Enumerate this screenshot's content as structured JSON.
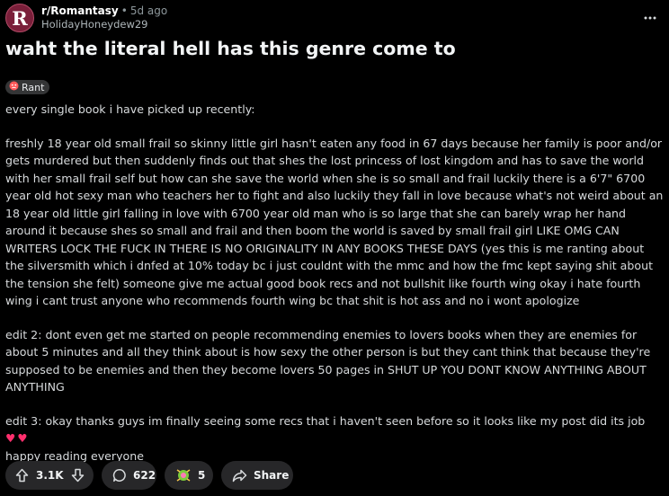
{
  "post": {
    "subreddit": "r/Romantasy",
    "separator": "•",
    "age": "5d ago",
    "author": "HolidayHoneydew29",
    "avatar_letter": "R",
    "title": "waht the literal hell has this genre come to",
    "flair": {
      "label": "Rant",
      "icon": "angry-face-icon"
    },
    "paragraphs": [
      "every single book i have picked up recently:",
      "freshly 18 year old small frail so skinny little girl hasn't eaten any food in 67 days because her family is poor and/or gets murdered but then suddenly finds out that shes the lost princess of lost kingdom and has to save the world with her small frail self but how can she save the world when she is so small and frail luckily there is a 6'7\" 6700 year old hot sexy man who teachers her to fight and also luckily they fall in love because what's not weird about an 18 year old little girl falling in love with 6700 year old man who is so large that she can barely wrap her hand around it because shes so small and frail and then boom the world is saved by small frail girl LIKE OMG CAN WRITERS LOCK THE FUCK IN THERE IS NO ORIGINALITY IN ANY BOOKS THESE DAYS (yes this is me ranting about the silversmith which i dnfed at 10% today bc i just couldnt with the mmc and how the fmc kept saying shit about the tension she felt) someone give me actual good book recs and not bullshit like fourth wing okay i hate fourth wing i cant trust anyone who recommends fourth wing bc that shit is hot ass and no i wont apologize",
      "edit 2: dont even get me started on people recommending enemies to lovers books when they are enemies for about 5 minutes and all they think about is how sexy the other person is but they cant think that because they're supposed to be enemies and then they become lovers 50 pages in SHUT UP YOU DONT KNOW ANYTHING ABOUT ANYTHING"
    ],
    "edit3_text": "edit 3: okay thanks guys im finally seeing some recs that i haven't seen before so it looks like my post did its job",
    "edit3_hearts": "♥♥",
    "edit3_tail": "happy reading everyone"
  },
  "actions": {
    "upvotes": "3.1K",
    "comments": "622",
    "awards": "5",
    "share_label": "Share"
  },
  "icons": {
    "more": "more-options-icon",
    "upvote": "upvote-arrow-icon",
    "downvote": "downvote-arrow-icon",
    "comment": "comment-bubble-icon",
    "award": "award-icon",
    "share": "share-arrow-icon"
  },
  "colors": {
    "background": "#000000",
    "text": "#d7dadc",
    "pill": "#272729",
    "heart": "#ff2f6d",
    "avatar": "#7a1f3a"
  }
}
